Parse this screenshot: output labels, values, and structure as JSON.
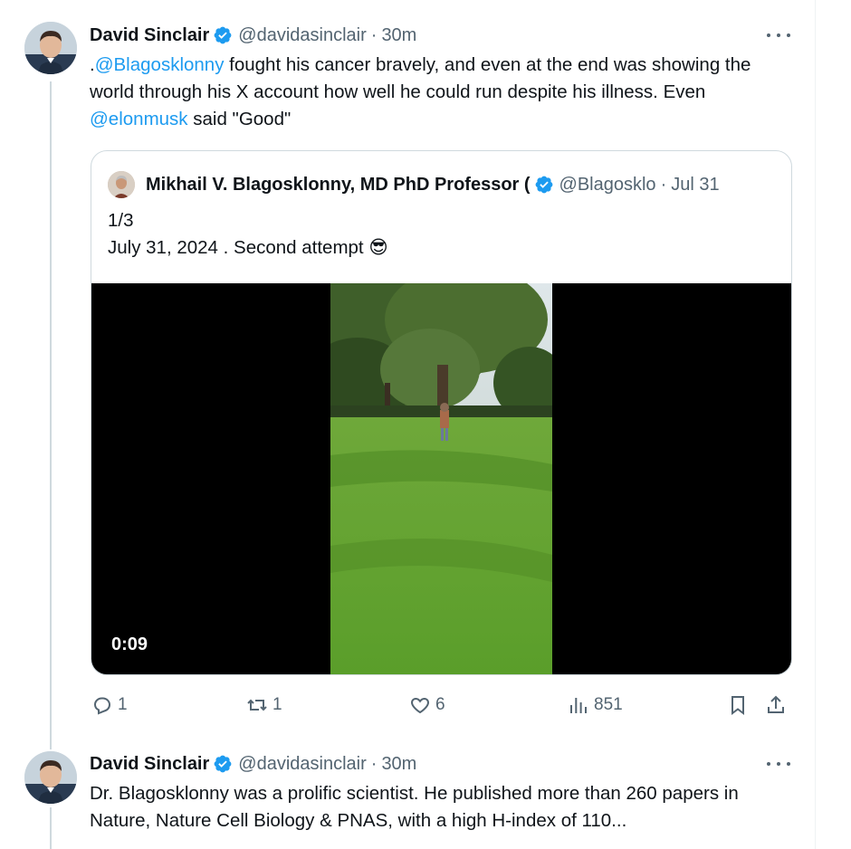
{
  "tweets": [
    {
      "author_name": "David Sinclair",
      "handle": "@davidasinclair",
      "separator": "·",
      "time": "30m",
      "text_lead": ".",
      "mention1": "@Blagosklonny",
      "text_mid": " fought his cancer bravely, and even at the end was showing the world through his X account how well he could run despite his illness. Even ",
      "mention2": "@elonmusk",
      "text_tail": " said \"Good\"",
      "quote": {
        "author_name": "Mikhail V. Blagosklonny, MD PhD Professor (",
        "handle": "@Blagosklo",
        "separator": "·",
        "time": "Jul 31",
        "line1": "1/3",
        "line2": "July 31, 2024 . Second attempt 😎",
        "video_duration": "0:09"
      },
      "actions": {
        "replies": "1",
        "reposts": "1",
        "likes": "6",
        "views": "851"
      }
    },
    {
      "author_name": "David Sinclair",
      "handle": "@davidasinclair",
      "separator": "·",
      "time": "30m",
      "text": "Dr. Blagosklonny was a prolific scientist. He published more than 260 papers in Nature, Nature Cell Biology & PNAS, with a high H-index of 110..."
    }
  ],
  "icons": {
    "verified": "verified-badge-icon",
    "more": "more-icon",
    "reply": "reply-icon",
    "repost": "repost-icon",
    "like": "heart-icon",
    "views": "views-icon",
    "bookmark": "bookmark-icon",
    "share": "share-icon"
  },
  "colors": {
    "accent": "#1d9bf0",
    "text": "#0f1419",
    "secondary": "#536471",
    "border": "#cfd9de"
  }
}
